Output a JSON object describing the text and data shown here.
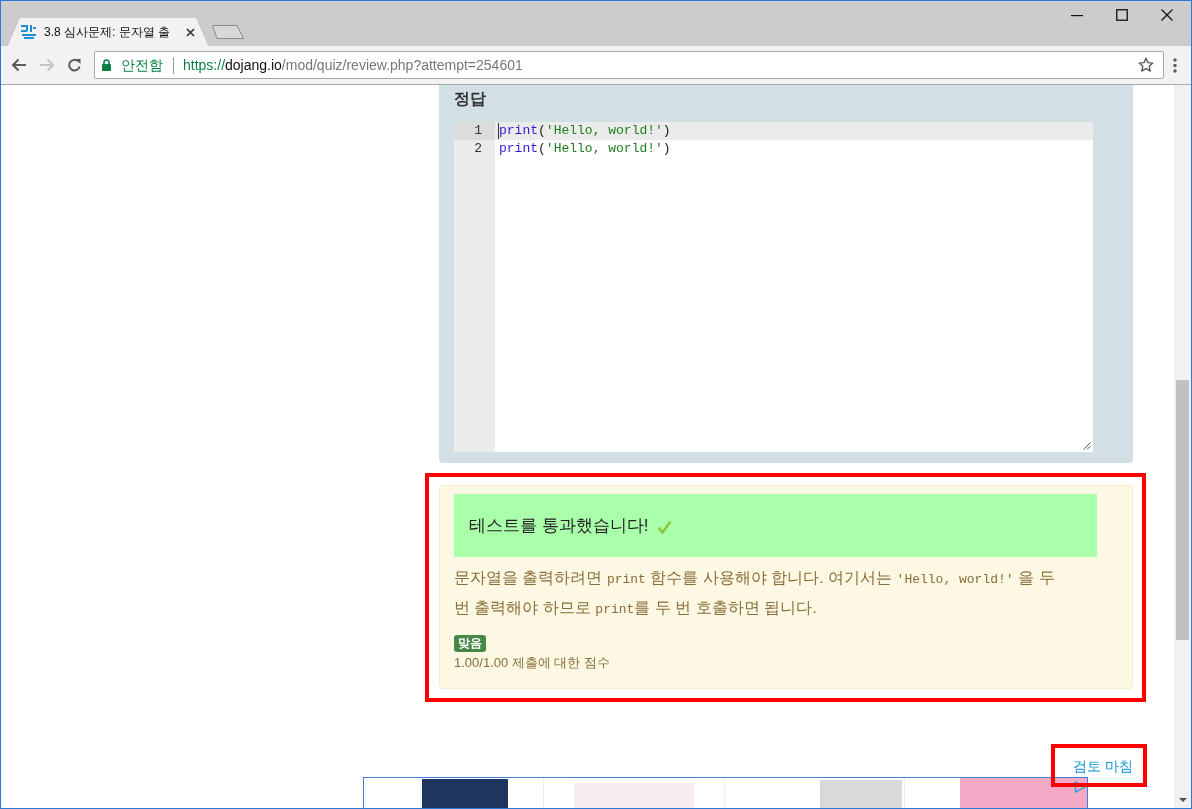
{
  "tabs": [
    {
      "title": "3.8 심사문제: 문자열 출",
      "selected": true
    }
  ],
  "navigation": {
    "back": {
      "disabled": false
    },
    "forward": {
      "disabled": true
    }
  },
  "address_bar": {
    "security_label": "안전함",
    "url": {
      "scheme": "https://",
      "host": "dojang.io",
      "path": "/mod/quiz/review.php?attempt=254601"
    }
  },
  "answer": {
    "heading": "정답",
    "code_lines": [
      {
        "number": "1",
        "active": true,
        "tokens": [
          {
            "kind": "builtin",
            "text": "print"
          },
          {
            "kind": "punct",
            "text": "("
          },
          {
            "kind": "string",
            "text": "'Hello, world!'"
          },
          {
            "kind": "punct",
            "text": ")"
          }
        ]
      },
      {
        "number": "2",
        "active": false,
        "tokens": [
          {
            "kind": "builtin",
            "text": "print"
          },
          {
            "kind": "punct",
            "text": "("
          },
          {
            "kind": "string",
            "text": "'Hello, world!'"
          },
          {
            "kind": "punct",
            "text": ")"
          }
        ]
      }
    ]
  },
  "feedback": {
    "highlighted": true,
    "passed": true,
    "message": "테스트를 통과했습니다!",
    "explanation": [
      {
        "kind": "text",
        "text": "문자열을 출력하려면 "
      },
      {
        "kind": "code",
        "text": "print"
      },
      {
        "kind": "text",
        "text": " 함수를 사용해야 합니다. 여기서는 "
      },
      {
        "kind": "code",
        "text": "'Hello, world!'"
      },
      {
        "kind": "text",
        "text": " 을 두 번 출력해야 하므로 "
      },
      {
        "kind": "code",
        "text": "print"
      },
      {
        "kind": "text",
        "text": "를 두 번 호출하면 됩니다."
      }
    ],
    "grade": "맞음",
    "score": "1.00/1.00 제출에 대한 점수"
  },
  "finish_link": {
    "label": "검토 마침",
    "highlighted": true
  }
}
